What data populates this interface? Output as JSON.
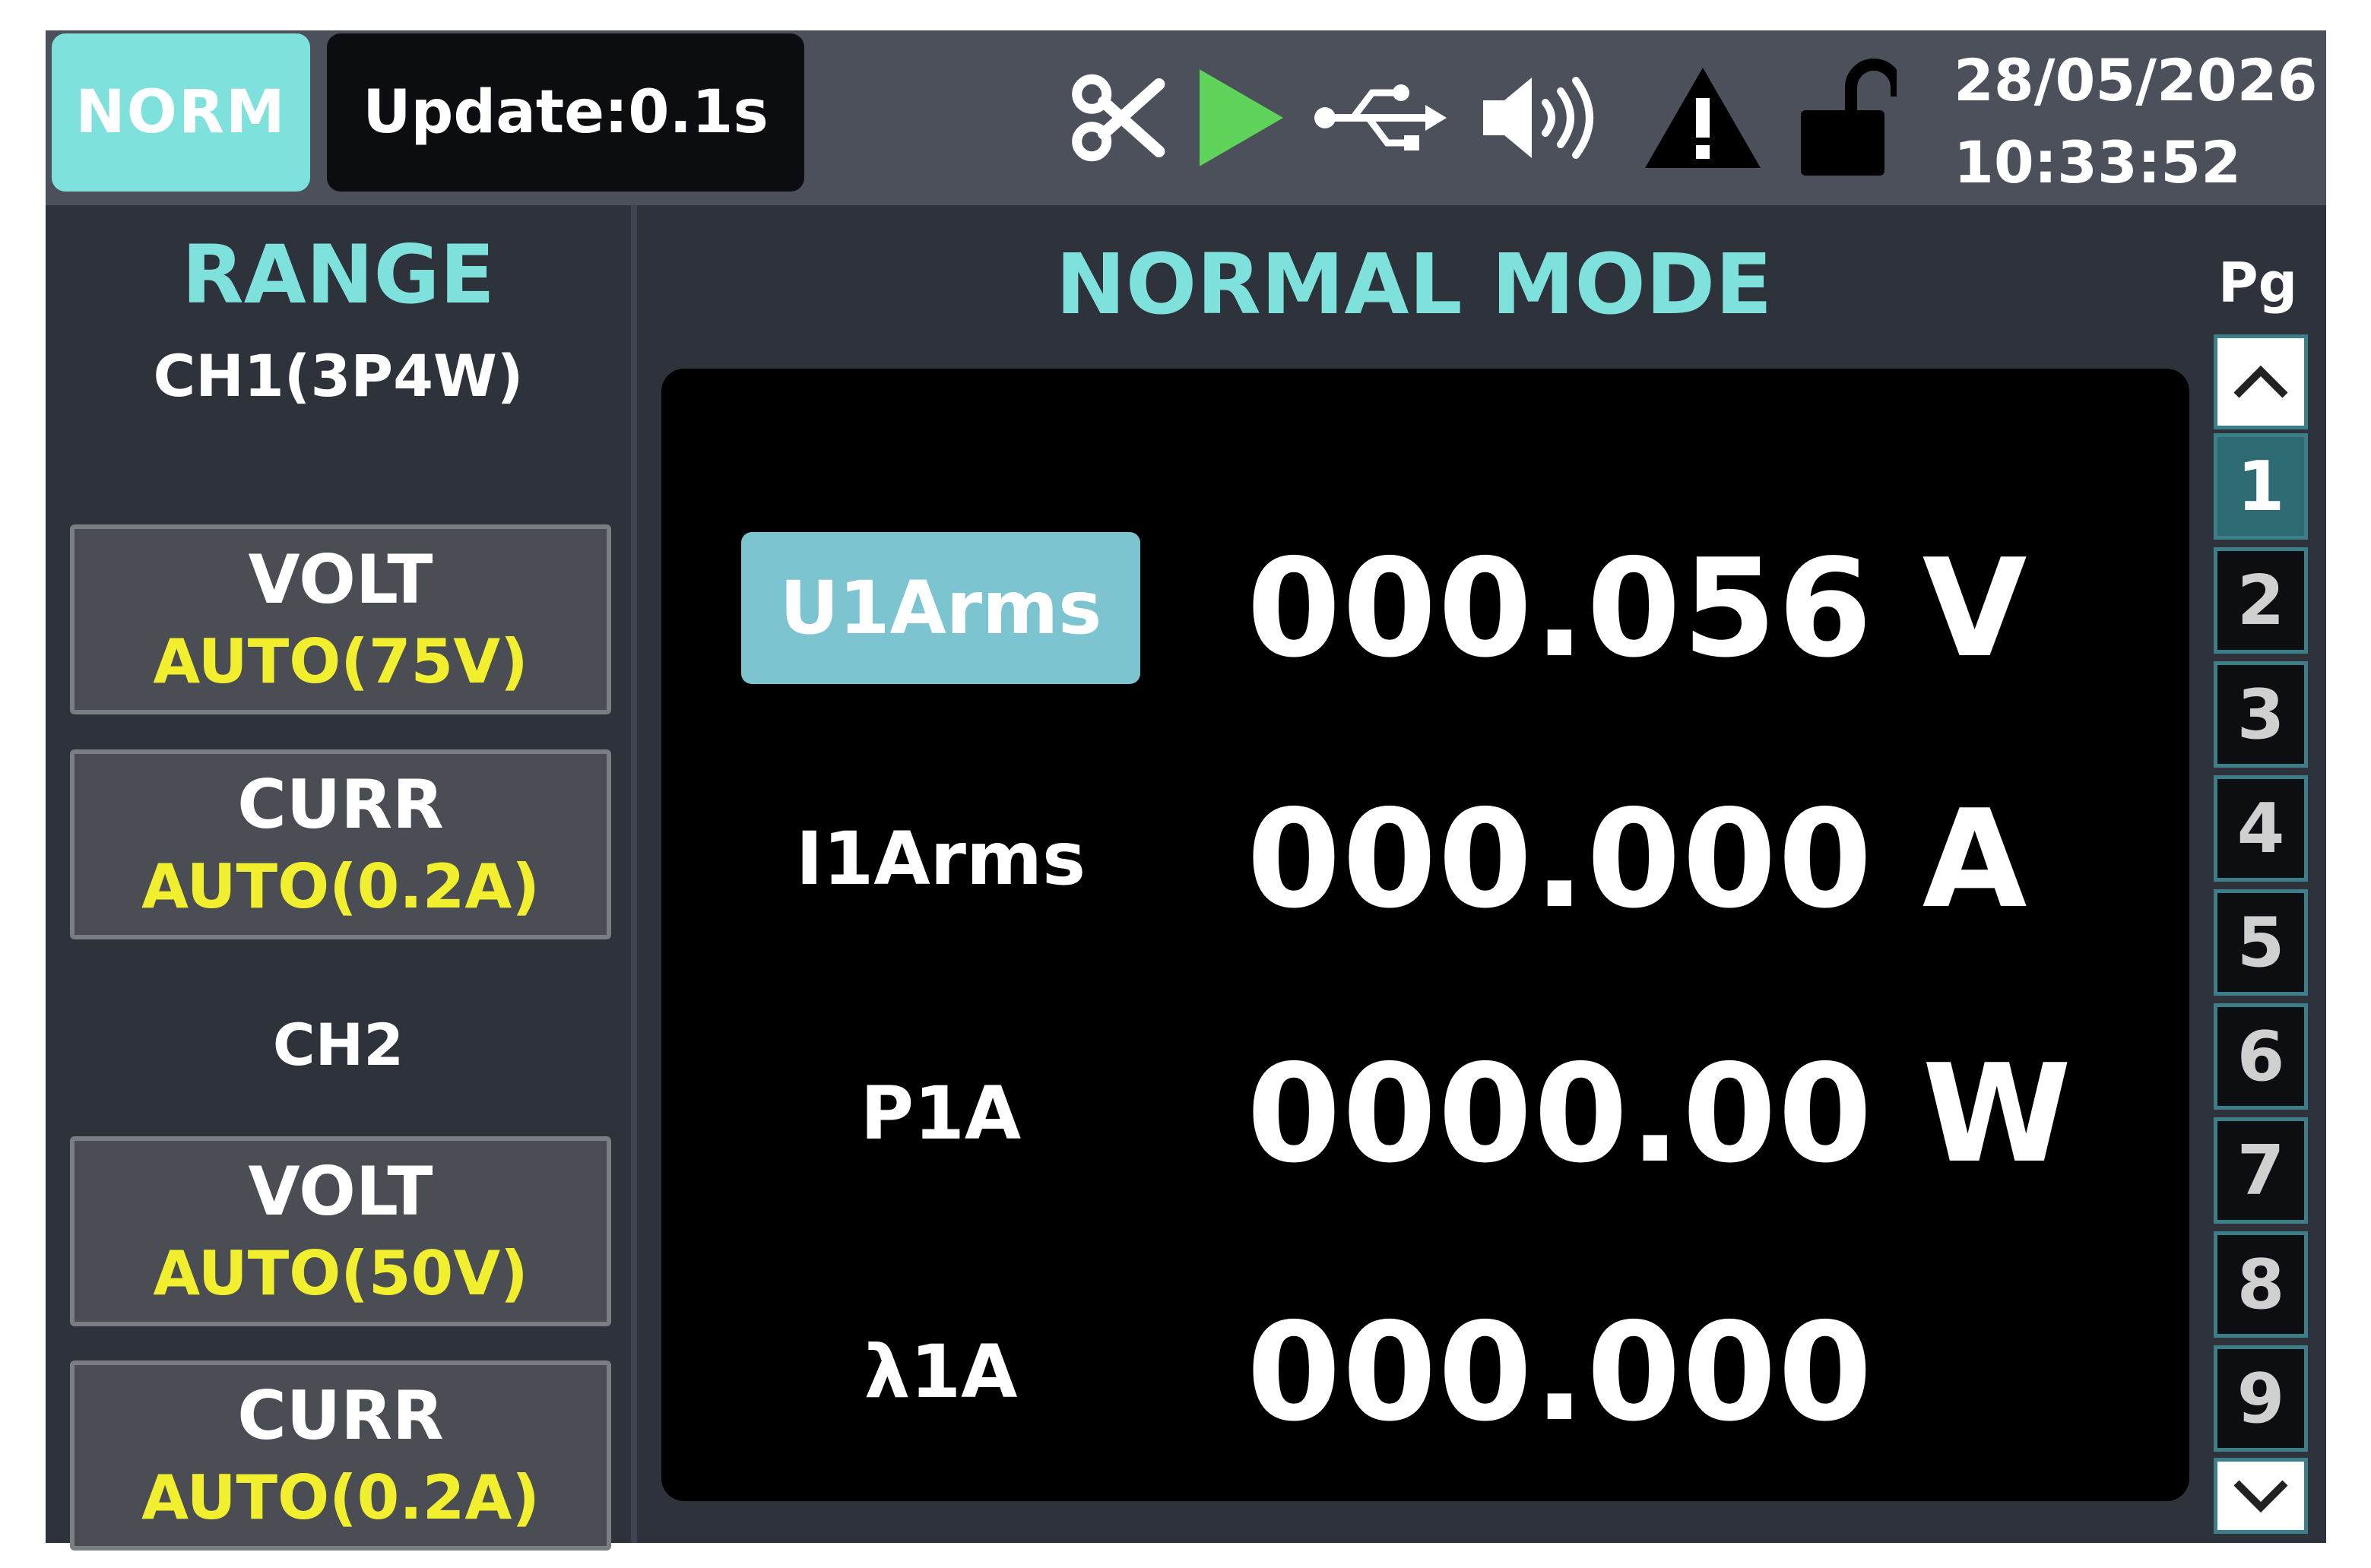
{
  "topbar": {
    "mode_badge": "NORM",
    "update_label": "Update:0.1s",
    "date": "28/05/2026",
    "time": "10:33:52",
    "icons": [
      "scissors-icon",
      "play-icon",
      "usb-icon",
      "speaker-icon",
      "warning-icon",
      "unlock-icon"
    ],
    "colors": {
      "play": "#5fd35a",
      "accent": "#7fe1dc"
    }
  },
  "range": {
    "title": "RANGE",
    "ch1": {
      "label": "CH1(3P4W)",
      "volt": {
        "name": "VOLT",
        "value": "AUTO(75V)"
      },
      "curr": {
        "name": "CURR",
        "value": "AUTO(0.2A)"
      }
    },
    "ch2": {
      "label": "CH2",
      "volt": {
        "name": "VOLT",
        "value": "AUTO(50V)"
      },
      "curr": {
        "name": "CURR",
        "value": "AUTO(0.2A)"
      }
    },
    "value_color": "#f1ef2e"
  },
  "main": {
    "title": "NORMAL MODE",
    "measurements": [
      {
        "label": "U1Arms",
        "value": "000.056 V",
        "selected": true
      },
      {
        "label": "I1Arms",
        "value": "000.000 A",
        "selected": false
      },
      {
        "label": "P1A",
        "value": "0000.00 W",
        "selected": false
      },
      {
        "label": "λ1A",
        "value": "000.000",
        "selected": false
      }
    ]
  },
  "pager": {
    "label": "Pg",
    "pages": [
      "1",
      "2",
      "3",
      "4",
      "5",
      "6",
      "7",
      "8",
      "9"
    ],
    "current": "1"
  }
}
